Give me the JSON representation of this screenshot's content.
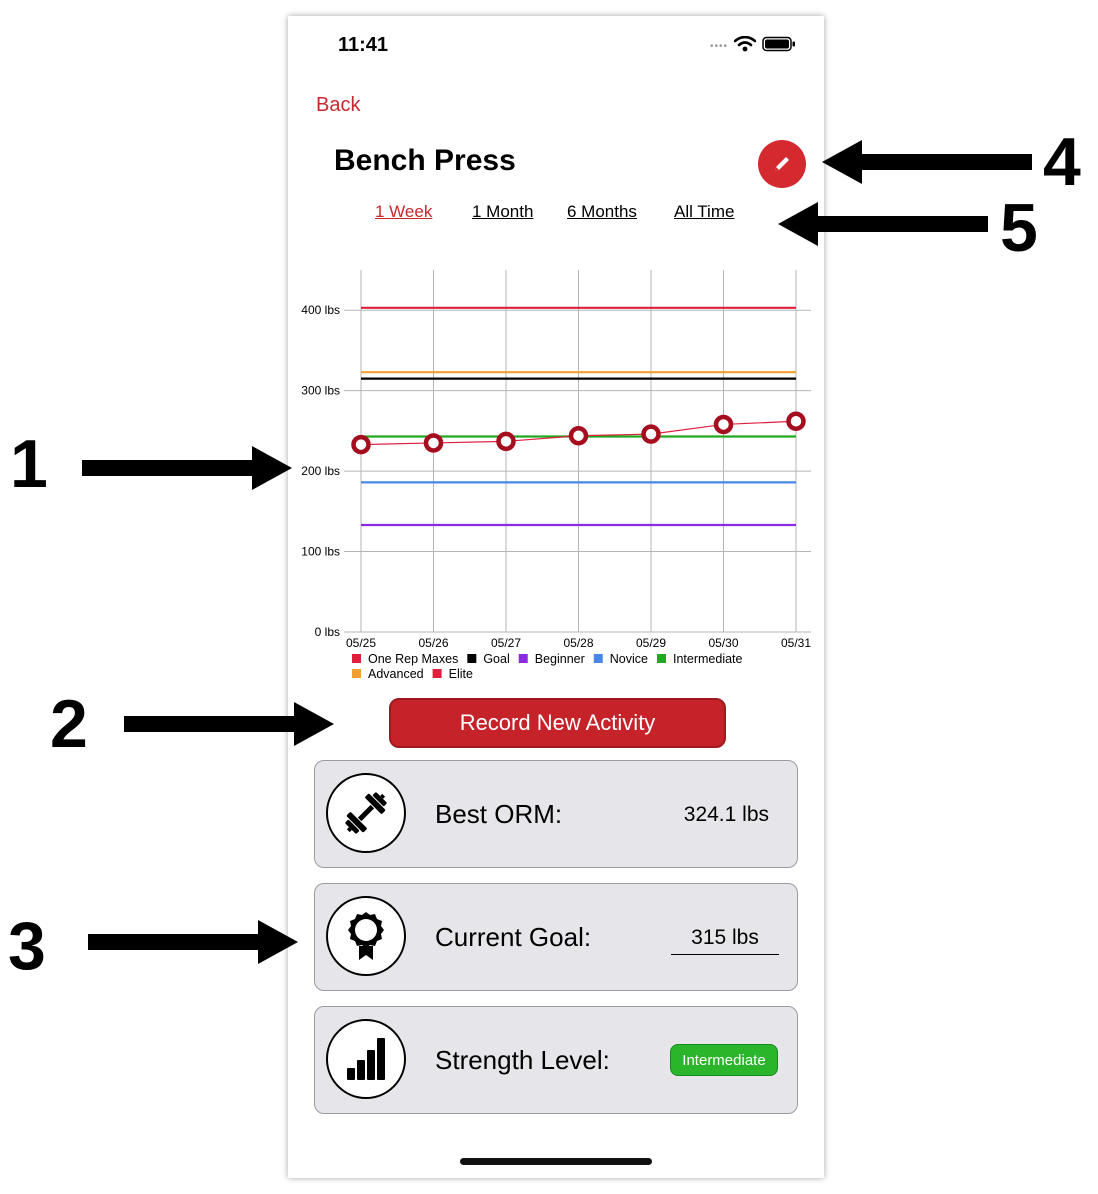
{
  "status_bar": {
    "time": "11:41"
  },
  "nav": {
    "back_label": "Back"
  },
  "title": "Bench Press",
  "tabs": [
    {
      "label": "1 Week",
      "active": true
    },
    {
      "label": "1 Month",
      "active": false
    },
    {
      "label": "6 Months",
      "active": false
    },
    {
      "label": "All Time",
      "active": false
    }
  ],
  "chart_data": {
    "type": "line",
    "title": "",
    "xlabel": "",
    "ylabel": "",
    "categories": [
      "05/25",
      "05/26",
      "05/27",
      "05/28",
      "05/29",
      "05/30",
      "05/31"
    ],
    "ylim": [
      0,
      450
    ],
    "yticks": [
      0,
      100,
      200,
      300,
      400
    ],
    "ytick_labels": [
      "0 lbs",
      "100 lbs",
      "200 lbs",
      "300 lbs",
      "400 lbs"
    ],
    "grid": true,
    "legend_position": "bottom",
    "series": [
      {
        "name": "One Rep Maxes",
        "color": "#e01f3d",
        "values": [
          233,
          235,
          237,
          244,
          246,
          258,
          262
        ],
        "markers": true
      },
      {
        "name": "Goal",
        "color": "#000000",
        "values": [
          315,
          315,
          315,
          315,
          315,
          315,
          315
        ]
      },
      {
        "name": "Beginner",
        "color": "#8a2be2",
        "values": [
          133,
          133,
          133,
          133,
          133,
          133,
          133
        ]
      },
      {
        "name": "Novice",
        "color": "#4a86e8",
        "values": [
          186,
          186,
          186,
          186,
          186,
          186,
          186
        ]
      },
      {
        "name": "Intermediate",
        "color": "#22a822",
        "values": [
          243,
          243,
          243,
          243,
          243,
          243,
          243
        ]
      },
      {
        "name": "Advanced",
        "color": "#f0a030",
        "values": [
          323,
          323,
          323,
          323,
          323,
          323,
          323
        ]
      },
      {
        "name": "Elite",
        "color": "#e01f3d",
        "values": [
          403,
          403,
          403,
          403,
          403,
          403,
          403
        ]
      }
    ],
    "marker_color": "#a50e1e"
  },
  "record_button": {
    "label": "Record New Activity"
  },
  "cards": {
    "best_orm": {
      "label": "Best ORM:",
      "value": "324.1 lbs",
      "icon": "dumbbell-icon"
    },
    "current_goal": {
      "label": "Current Goal:",
      "value": "315 lbs",
      "icon": "award-ribbon-icon"
    },
    "strength_level": {
      "label": "Strength Level:",
      "value": "Intermediate",
      "icon": "bar-chart-icon",
      "badge_color": "#2ab52b"
    }
  },
  "callouts": [
    "1",
    "2",
    "3",
    "4",
    "5"
  ]
}
